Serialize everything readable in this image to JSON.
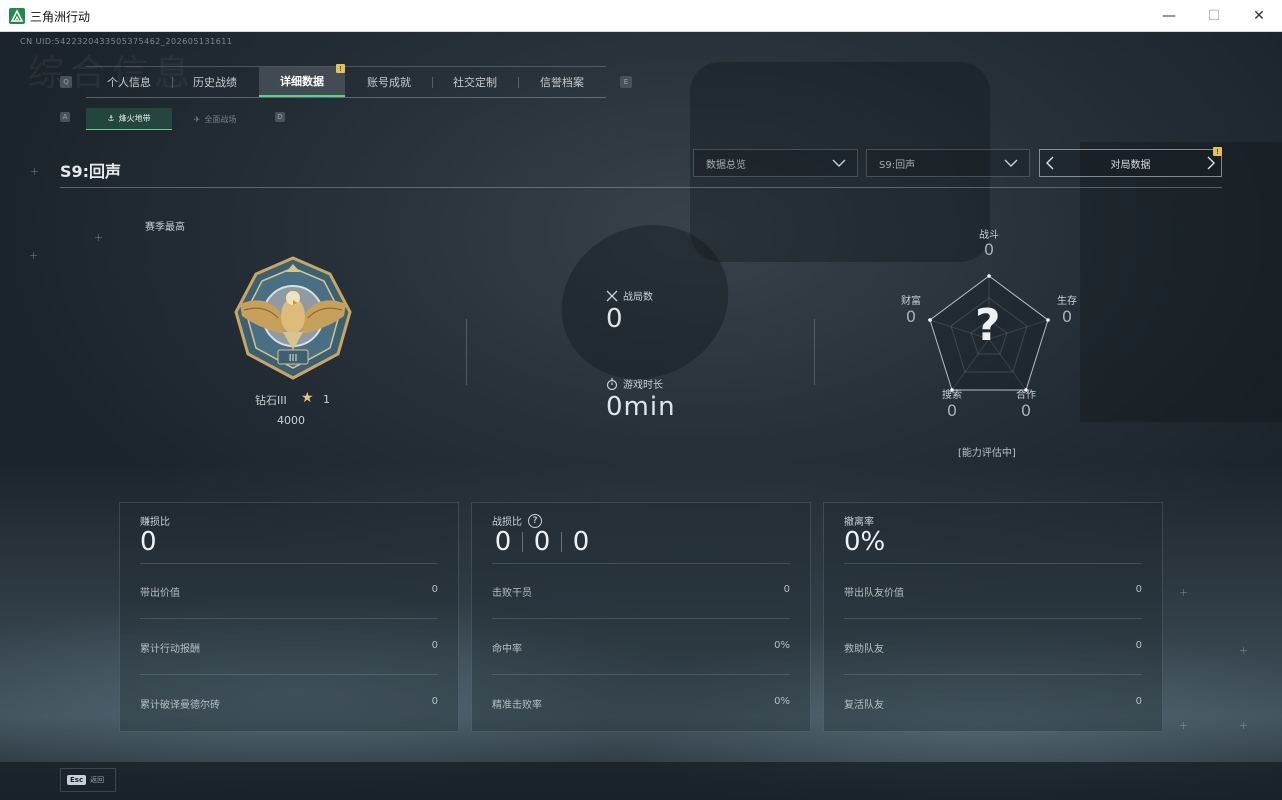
{
  "window": {
    "title": "三角洲行动",
    "minimize": "—",
    "maximize": "☐",
    "close": "✕"
  },
  "header": {
    "uid": "CN UID:5422320433505375462_202605131611",
    "bg_title": "综合信息"
  },
  "tabs": {
    "left_key": "Q",
    "right_key": "E",
    "items": [
      {
        "label": "个人信息"
      },
      {
        "label": "历史战绩"
      },
      {
        "label": "详细数据"
      },
      {
        "label": "账号成就"
      },
      {
        "label": "社交定制"
      },
      {
        "label": "信誉档案"
      }
    ],
    "active_index": 2,
    "notif_badge": "!"
  },
  "subtabs": {
    "left_key": "A",
    "right_key": "D",
    "items": [
      {
        "label": "烽火地带",
        "icon": "hazard-icon"
      },
      {
        "label": "全面战场",
        "icon": "battlefield-icon"
      }
    ],
    "active_index": 0
  },
  "season": {
    "title": "S9:回声",
    "filter_type": "数据总览",
    "filter_season": "S9:回声",
    "nav_label": "对局数据",
    "nav_badge": "!"
  },
  "rank": {
    "season_best_label": "赛季最高",
    "name": "钻石III",
    "star_icon": "★",
    "stars": "1",
    "score": "4000",
    "medal_numeral": "III"
  },
  "middle": {
    "matches_label": "战局数",
    "matches_value": "0",
    "playtime_label": "游戏时长",
    "playtime_value": "0min"
  },
  "radar": {
    "combat_label": "战斗",
    "combat_value": "0",
    "survival_label": "生存",
    "survival_value": "0",
    "coop_label": "合作",
    "coop_value": "0",
    "search_label": "搜索",
    "search_value": "0",
    "wealth_label": "财富",
    "wealth_value": "0",
    "center_mark": "?",
    "status": "[能力评估中]"
  },
  "cards": {
    "profit": {
      "title": "赚损比",
      "value": "0",
      "rows": [
        {
          "label": "带出价值",
          "value": "0"
        },
        {
          "label": "累计行动报酬",
          "value": "0"
        },
        {
          "label": "累计破译曼德尔砖",
          "value": "0"
        }
      ]
    },
    "kd": {
      "title": "战损比",
      "help": "?",
      "values": [
        "0",
        "0",
        "0"
      ],
      "rows": [
        {
          "label": "击败干员",
          "value": "0"
        },
        {
          "label": "命中率",
          "value": "0%"
        },
        {
          "label": "精准击败率",
          "value": "0%"
        }
      ]
    },
    "extract": {
      "title": "撤离率",
      "value": "0%",
      "rows": [
        {
          "label": "带出队友价值",
          "value": "0"
        },
        {
          "label": "救助队友",
          "value": "0"
        },
        {
          "label": "复活队友",
          "value": "0"
        }
      ]
    }
  },
  "footer": {
    "esc_key": "Esc",
    "esc_label": "返回"
  },
  "colors": {
    "accent": "#58d38a",
    "badge": "#e2c35b",
    "background": "#1b2329"
  }
}
